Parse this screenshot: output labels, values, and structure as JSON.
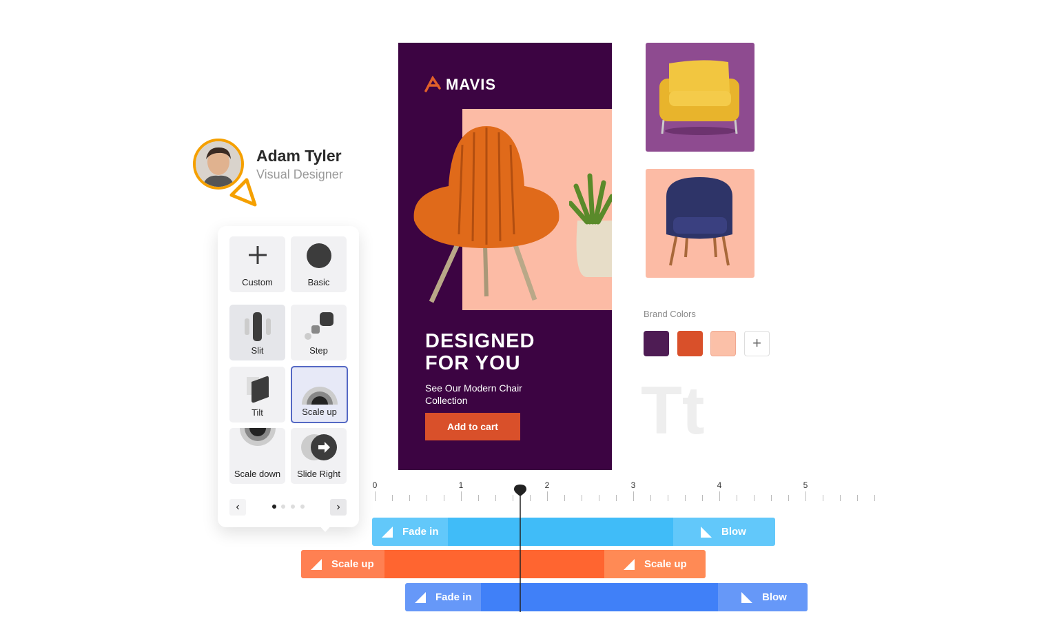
{
  "user": {
    "name": "Adam Tyler",
    "role": "Visual Designer"
  },
  "animations": {
    "items": [
      {
        "label": "Custom",
        "icon": "plus-icon"
      },
      {
        "label": "Basic",
        "icon": "circle-icon"
      },
      {
        "label": "Slit",
        "icon": "slit-icon",
        "state": "hover"
      },
      {
        "label": "Step",
        "icon": "step-icon"
      },
      {
        "label": "Tilt",
        "icon": "tilt-icon"
      },
      {
        "label": "Scale up",
        "icon": "scale-up-icon",
        "state": "selected"
      },
      {
        "label": "Scale down",
        "icon": "scale-down-icon"
      },
      {
        "label": "Slide Right",
        "icon": "slide-right-icon"
      }
    ],
    "prev": "‹",
    "next": "›",
    "page": 1,
    "pages": 4
  },
  "poster": {
    "brand": "MAVIS",
    "headline1": "DESIGNED",
    "headline2": "FOR YOU",
    "sub1": "See Our Modern Chair",
    "sub2": "Collection",
    "cta": "Add to cart"
  },
  "brand": {
    "title": "Brand Colors",
    "colors": [
      "#4e1c54",
      "#d9502a",
      "#fbc0a8"
    ],
    "add": "+",
    "type_sample": "Tt"
  },
  "timeline": {
    "ticks": [
      "0",
      "1",
      "2",
      "3",
      "4",
      "5"
    ],
    "playhead": 1.69,
    "tracks": [
      {
        "color": "#40bcf8",
        "in": "Fade in",
        "out": "Blow"
      },
      {
        "color": "#ff6530",
        "in": "Scale up",
        "out": "Scale up"
      },
      {
        "color": "#4080f8",
        "in": "Fade in",
        "out": "Blow"
      }
    ]
  }
}
